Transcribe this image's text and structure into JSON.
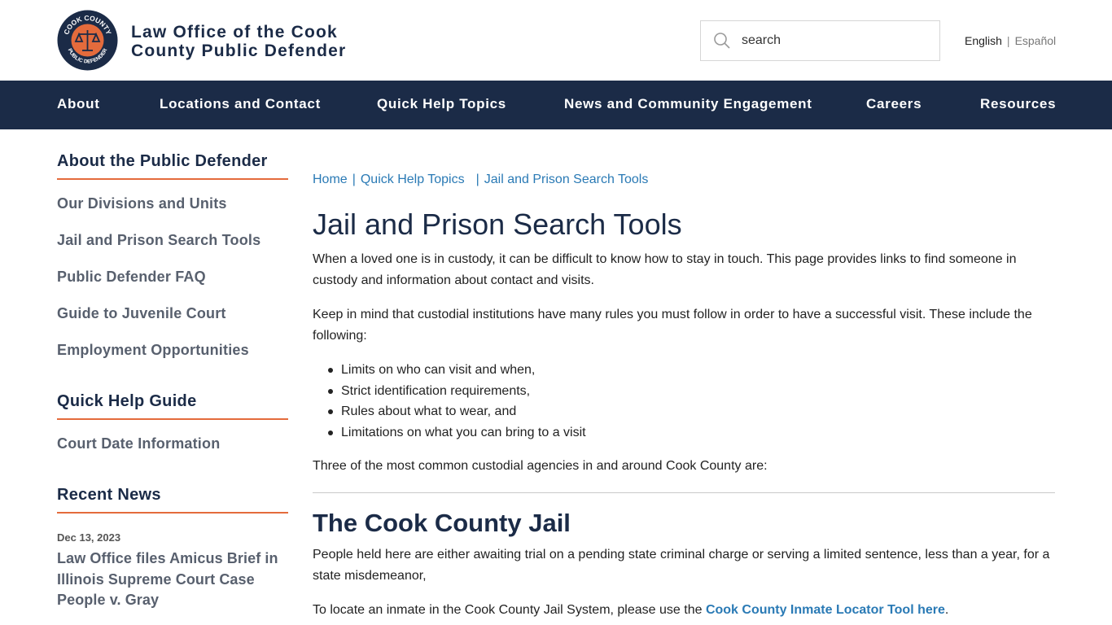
{
  "header": {
    "logo": {
      "top_text": "COOK COUNTY",
      "bottom_text": "PUBLIC DEFENDER"
    },
    "title_line1": "Law Office of the Cook",
    "title_line2": "County Public Defender",
    "search_placeholder": "search",
    "lang_english": "English",
    "lang_separator": "|",
    "lang_spanish": "Español"
  },
  "nav": {
    "items": [
      "About",
      "Locations and Contact",
      "Quick Help Topics",
      "News and Community Engagement",
      "Careers",
      "Resources"
    ]
  },
  "sidebar": {
    "about_heading": "About the Public Defender",
    "about_links": [
      "Our Divisions and Units",
      "Jail and Prison Search Tools",
      "Public Defender FAQ",
      "Guide to Juvenile Court",
      "Employment Opportunities"
    ],
    "quick_heading": "Quick Help Guide",
    "quick_links": [
      "Court Date Information"
    ],
    "news_heading": "Recent News",
    "news": {
      "date": "Dec 13, 2023",
      "title": "Law Office files Amicus Brief in Illinois Supreme Court Case People v. Gray"
    }
  },
  "main": {
    "breadcrumb": {
      "home": "Home",
      "sep": "|",
      "level1": "Quick Help Topics",
      "current": "Jail and Prison Search Tools"
    },
    "title": "Jail and Prison Search Tools",
    "intro": "When a loved one is in custody, it can be difficult to know how to stay in touch. This page provides links to find someone in custody and information about contact and visits.",
    "rules_intro": "Keep in mind that custodial institutions have many rules you must follow in order to have a successful visit. These include the following:",
    "rules": [
      "Limits on who can visit and when,",
      "Strict identification requirements,",
      "Rules about what to wear, and",
      "Limitations on what you can bring to a visit"
    ],
    "agencies_intro": "Three of the most common custodial agencies in and around Cook County are:",
    "jail_heading": "The Cook County Jail",
    "jail_desc": "People held here are either awaiting trial on a pending state criminal charge or serving a limited sentence, less than a year, for a state misdemeanor,",
    "locator_prefix": "To locate an inmate in the Cook County Jail System, please use the ",
    "locator_link": "Cook County Inmate Locator Tool here",
    "locator_suffix": "."
  },
  "colors": {
    "navy": "#1b2b47",
    "accent_orange": "#e46b3c",
    "link_blue": "#2a7ab5",
    "sidebar_gray": "#58606e"
  }
}
